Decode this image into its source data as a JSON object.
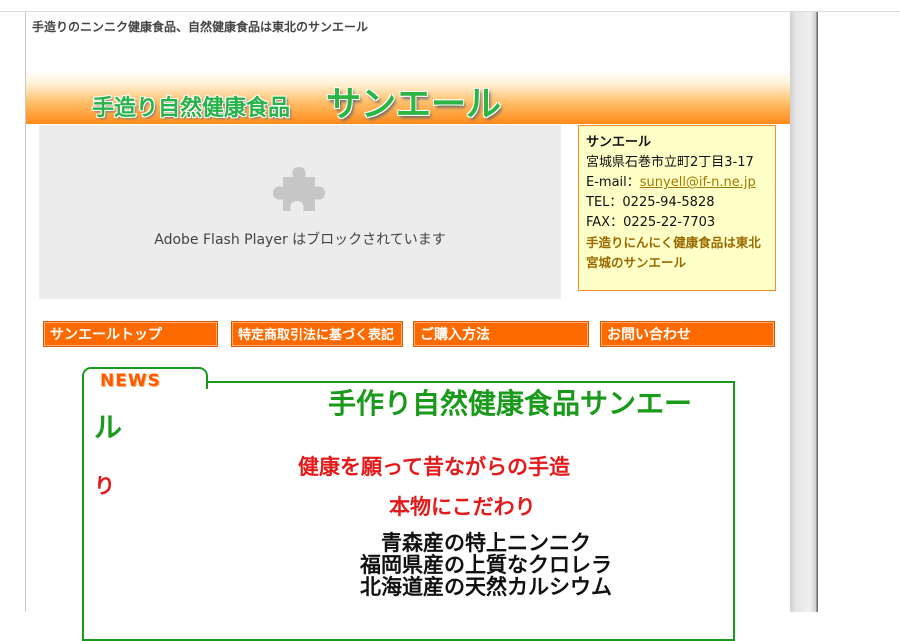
{
  "tagline": "手造りのニンニク健康食品、自然健康食品は東北のサンエール",
  "banner": {
    "subtitle": "手造り自然健康食品",
    "brand": "サンエール"
  },
  "flash": {
    "icon": "puzzle-piece-icon",
    "message": "Adobe Flash Player はブロックされています"
  },
  "contact": {
    "name": "サンエール",
    "address": "宮城県石巻市立町2丁目3-17",
    "email_label": "E-mail：",
    "email": "sunyell@if-n.ne.jp",
    "tel": "TEL：0225-94-5828",
    "fax": "FAX：0225-22-7703",
    "promo_line1": "手造りにんにく健康食品は東北",
    "promo_line2": "宮城のサンエール"
  },
  "nav": [
    {
      "label": "サンエールトップ"
    },
    {
      "label": "特定商取引法に基づく表記"
    },
    {
      "label": "ご購入方法"
    },
    {
      "label": "お問い合わせ"
    }
  ],
  "news": {
    "tab_label": "NEWS",
    "headline1": "手作り自然健康食品サンエー",
    "headline1_wrap": "ル",
    "headline2": "健康を願って昔ながらの手造",
    "headline2_wrap": "り",
    "headline3": "本物にこだわり",
    "products": [
      "青森産の特上ニンニク",
      "福岡県産の上質なクロレラ",
      "北海道産の天然カルシウム"
    ]
  },
  "colors": {
    "accent_orange": "#ff6a00",
    "brand_green": "#1a9a1a",
    "headline_red": "#e41a1a",
    "contact_bg": "#ffffc8"
  }
}
